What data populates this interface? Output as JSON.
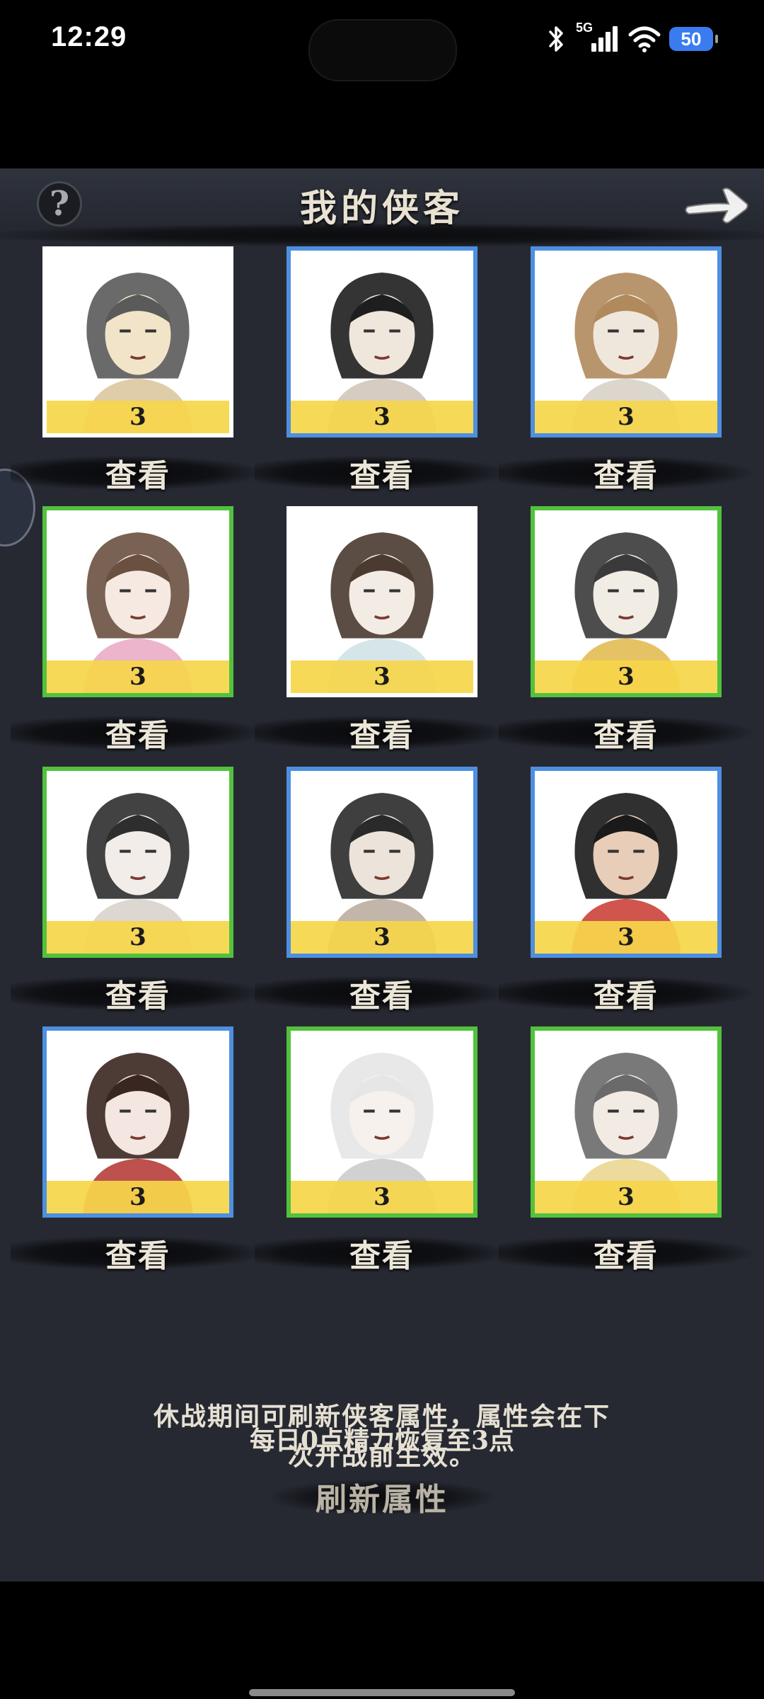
{
  "status_bar": {
    "time": "12:29",
    "network": "5G",
    "battery": "50"
  },
  "header": {
    "title": "我的侠客",
    "help_symbol": "?"
  },
  "heroes": [
    {
      "level": "3",
      "view_label": "查看",
      "frame_color": "#ffffff",
      "icon": "bandit-man-portrait"
    },
    {
      "level": "3",
      "view_label": "查看",
      "frame_color": "#4d8fe0",
      "icon": "swordsman-portrait"
    },
    {
      "level": "3",
      "view_label": "查看",
      "frame_color": "#4d8fe0",
      "icon": "fur-hat-warrior-portrait"
    },
    {
      "level": "3",
      "view_label": "查看",
      "frame_color": "#52c13d",
      "icon": "flower-maiden-portrait"
    },
    {
      "level": "3",
      "view_label": "查看",
      "frame_color": "#ffffff",
      "icon": "young-girl-portrait"
    },
    {
      "level": "3",
      "view_label": "查看",
      "frame_color": "#52c13d",
      "icon": "crowned-lady-portrait"
    },
    {
      "level": "3",
      "view_label": "查看",
      "frame_color": "#52c13d",
      "icon": "veiled-lady-portrait"
    },
    {
      "level": "3",
      "view_label": "查看",
      "frame_color": "#4d8fe0",
      "icon": "scarred-fighter-portrait"
    },
    {
      "level": "3",
      "view_label": "查看",
      "frame_color": "#4d8fe0",
      "icon": "red-scarf-youth-portrait"
    },
    {
      "level": "3",
      "view_label": "查看",
      "frame_color": "#4d8fe0",
      "icon": "hairpin-lady-portrait"
    },
    {
      "level": "3",
      "view_label": "查看",
      "frame_color": "#52c13d",
      "icon": "white-hair-lady-portrait"
    },
    {
      "level": "3",
      "view_label": "查看",
      "frame_color": "#52c13d",
      "icon": "scholar-portrait"
    }
  ],
  "info": {
    "energy_text": "每日0点精力恢复至3点",
    "refresh_label": "刷新属性",
    "notice_line1": "休战期间可刷新侠客属性，属性会在下",
    "notice_line2": "次开战前生效。"
  },
  "colors": {
    "panel_bg": "#262932",
    "level_strip": "#f6d64a",
    "frame_blue": "#4d8fe0",
    "frame_green": "#52c13d"
  }
}
